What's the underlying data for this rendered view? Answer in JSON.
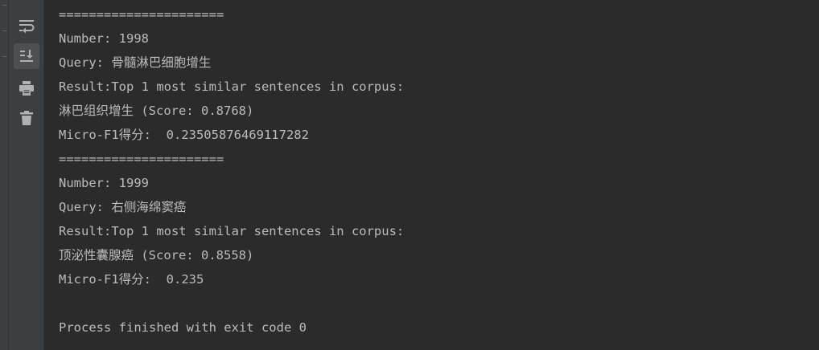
{
  "toolbar": {
    "buttons": [
      {
        "icon": "soft-wrap-icon",
        "active": false
      },
      {
        "icon": "scroll-to-end-icon",
        "active": true
      },
      {
        "icon": "print-icon",
        "active": false
      },
      {
        "icon": "trash-icon",
        "active": false
      }
    ],
    "icon_color": "#afb1b3"
  },
  "console": {
    "text_color": "#bbbbbb",
    "lines": [
      "======================",
      "Number: 1998",
      "Query: 骨髓淋巴细胞增生",
      "Result:Top 1 most similar sentences in corpus:",
      "淋巴组织增生 (Score: 0.8768)",
      "Micro-F1得分:  0.23505876469117282",
      "======================",
      "Number: 1999",
      "Query: 右侧海绵窦癌",
      "Result:Top 1 most similar sentences in corpus:",
      "顶泌性囊腺癌 (Score: 0.8558)",
      "Micro-F1得分:  0.235",
      "",
      "Process finished with exit code 0"
    ]
  }
}
